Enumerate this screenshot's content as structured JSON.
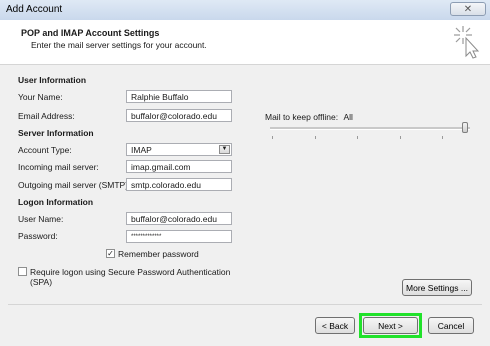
{
  "window": {
    "title": "Add Account",
    "close_glyph": "✕"
  },
  "header": {
    "title": "POP and IMAP Account Settings",
    "subtitle": "Enter the mail server settings for your account.",
    "icon": "sparkle-cursor-icon"
  },
  "user_information": {
    "heading": "User Information",
    "your_name_label": "Your Name:",
    "your_name_value": "Ralphie Buffalo",
    "email_label": "Email Address:",
    "email_value": "buffalor@colorado.edu"
  },
  "server_information": {
    "heading": "Server Information",
    "account_type_label": "Account Type:",
    "account_type_value": "IMAP",
    "incoming_label": "Incoming mail server:",
    "incoming_value": "imap.gmail.com",
    "outgoing_label": "Outgoing mail server (SMTP):",
    "outgoing_value": "smtp.colorado.edu"
  },
  "logon_information": {
    "heading": "Logon Information",
    "user_name_label": "User Name:",
    "user_name_value": "buffalor@colorado.edu",
    "password_label": "Password:",
    "password_value": "*************",
    "remember_password_label": "Remember password",
    "remember_password_checked": true,
    "spa_label_line1": "Require logon using Secure Password Authentication",
    "spa_label_line2": "(SPA)",
    "spa_checked": false
  },
  "offline": {
    "label": "Mail to keep offline:",
    "value": "All",
    "slider_level": 1.0
  },
  "buttons": {
    "more_settings": "More Settings ...",
    "back": "< Back",
    "next": "Next >",
    "cancel": "Cancel"
  },
  "colors": {
    "highlight": "#21e22b"
  }
}
